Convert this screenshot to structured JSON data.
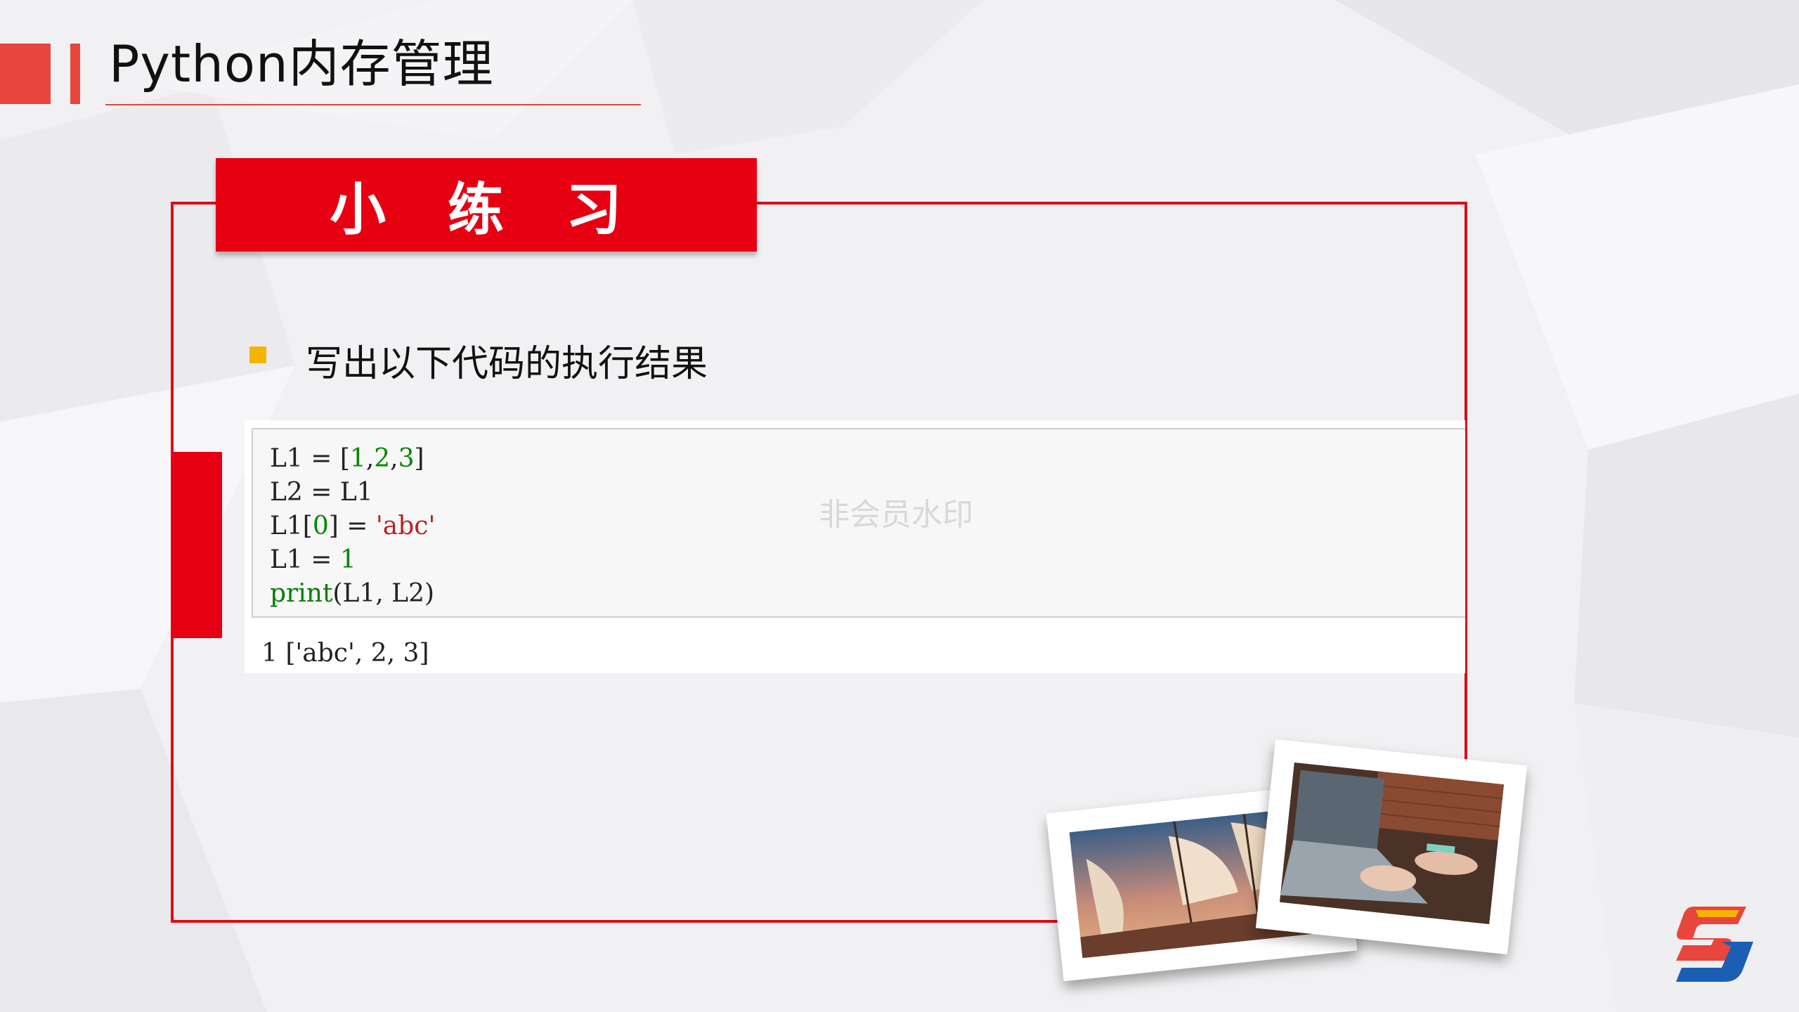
{
  "page": {
    "title": "Python内存管理"
  },
  "exercise": {
    "heading": "小 练 习",
    "bullet_text": "写出以下代码的执行结果"
  },
  "code": {
    "line1": {
      "a": "L1 = [",
      "n1": "1",
      "c1": ",",
      "n2": "2",
      "c2": ",",
      "n3": "3",
      "b": "]"
    },
    "line2": "L2 = L1",
    "line3": {
      "a": "L1[",
      "n": "0",
      "b": "] = ",
      "s": "'abc'"
    },
    "line4": {
      "a": "L1 = ",
      "n": "1"
    },
    "line5": {
      "fn": "print",
      "args": "(L1, L2)"
    },
    "output": "1 ['abc', 2, 3]"
  },
  "watermark": "非会员水印",
  "colors": {
    "accent_red": "#e60012",
    "title_red": "#e8453c",
    "bullet": "#f5b400"
  },
  "icons": {
    "logo": "sj-logo-icon",
    "photo1": "sailing-ship-photo",
    "photo2": "laptop-typing-photo"
  }
}
